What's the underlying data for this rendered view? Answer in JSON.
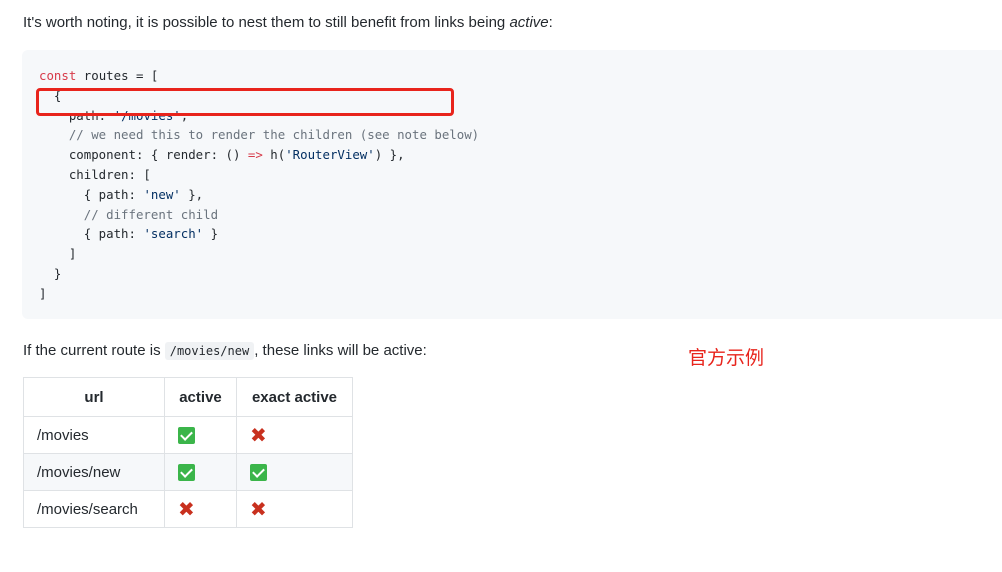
{
  "intro": {
    "before": "It's worth noting, it is possible to nest them to still benefit from links being ",
    "emphasis": "active",
    "after": ":"
  },
  "code": {
    "lines": [
      [
        {
          "t": "kw",
          "v": "const"
        },
        {
          "t": "",
          "v": " routes = ["
        }
      ],
      [
        {
          "t": "",
          "v": "  {"
        }
      ],
      [
        {
          "t": "",
          "v": "    path: "
        },
        {
          "t": "str",
          "v": "'/movies'"
        },
        {
          "t": "",
          "v": ","
        }
      ],
      [
        {
          "t": "cmt",
          "v": "    // we need this to render the children (see note below)"
        }
      ],
      [
        {
          "t": "",
          "v": "    component: { render: () "
        },
        {
          "t": "kw",
          "v": "=>"
        },
        {
          "t": "",
          "v": " h("
        },
        {
          "t": "str",
          "v": "'RouterView'"
        },
        {
          "t": "",
          "v": ") },"
        }
      ],
      [
        {
          "t": "",
          "v": "    children: ["
        }
      ],
      [
        {
          "t": "",
          "v": "      { path: "
        },
        {
          "t": "str",
          "v": "'new'"
        },
        {
          "t": "",
          "v": " },"
        }
      ],
      [
        {
          "t": "cmt",
          "v": "      // different child"
        }
      ],
      [
        {
          "t": "",
          "v": "      { path: "
        },
        {
          "t": "str",
          "v": "'search'"
        },
        {
          "t": "",
          "v": " }"
        }
      ],
      [
        {
          "t": "",
          "v": "    ]"
        }
      ],
      [
        {
          "t": "",
          "v": "  }"
        }
      ],
      [
        {
          "t": "",
          "v": "]"
        }
      ]
    ]
  },
  "route_text": {
    "before": "If the current route is ",
    "code": "/movies/new",
    "after": ", these links will be active:"
  },
  "annotation": "官方示例",
  "table": {
    "headers": [
      "url",
      "active",
      "exact active"
    ],
    "rows": [
      {
        "url": "/movies",
        "active": "check",
        "exact": "cross"
      },
      {
        "url": "/movies/new",
        "active": "check",
        "exact": "check"
      },
      {
        "url": "/movies/search",
        "active": "cross",
        "exact": "cross"
      }
    ],
    "check_color": "#3bb54a",
    "cross_color": "#c8301e"
  },
  "colors": {
    "highlight": "#e8241c",
    "code_bg": "#f6f8fa"
  }
}
